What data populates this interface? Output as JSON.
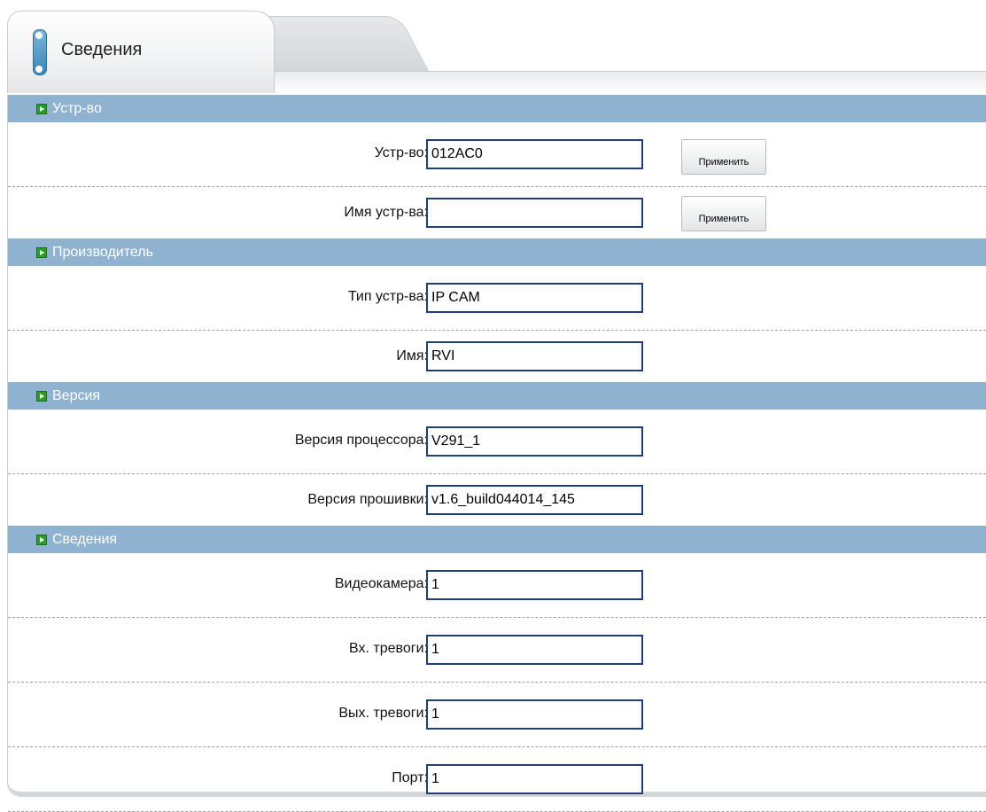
{
  "tab": {
    "title": "Сведения"
  },
  "sections": [
    {
      "title": "Устр-во",
      "rows": [
        {
          "label": "Устр-во:",
          "value": "012AC0",
          "button": "Применить"
        },
        {
          "label": "Имя устр-ва:",
          "value": "",
          "button": "Применить"
        }
      ]
    },
    {
      "title": "Производитель",
      "rows": [
        {
          "label": "Тип устр-ва:",
          "value": "IP CAM"
        },
        {
          "label": "Имя:",
          "value": "RVI"
        }
      ]
    },
    {
      "title": "Версия",
      "rows": [
        {
          "label": "Версия процессора:",
          "value": "V291_1"
        },
        {
          "label": "Версия прошивки:",
          "value": "v1.6_build044014_145"
        }
      ]
    },
    {
      "title": "Сведения",
      "rows": [
        {
          "label": "Видеокамера:",
          "value": "1"
        },
        {
          "label": "Вх. тревоги:",
          "value": "1"
        },
        {
          "label": "Вых. тревоги:",
          "value": "1"
        },
        {
          "label": "Порт:",
          "value": "1"
        }
      ]
    }
  ]
}
